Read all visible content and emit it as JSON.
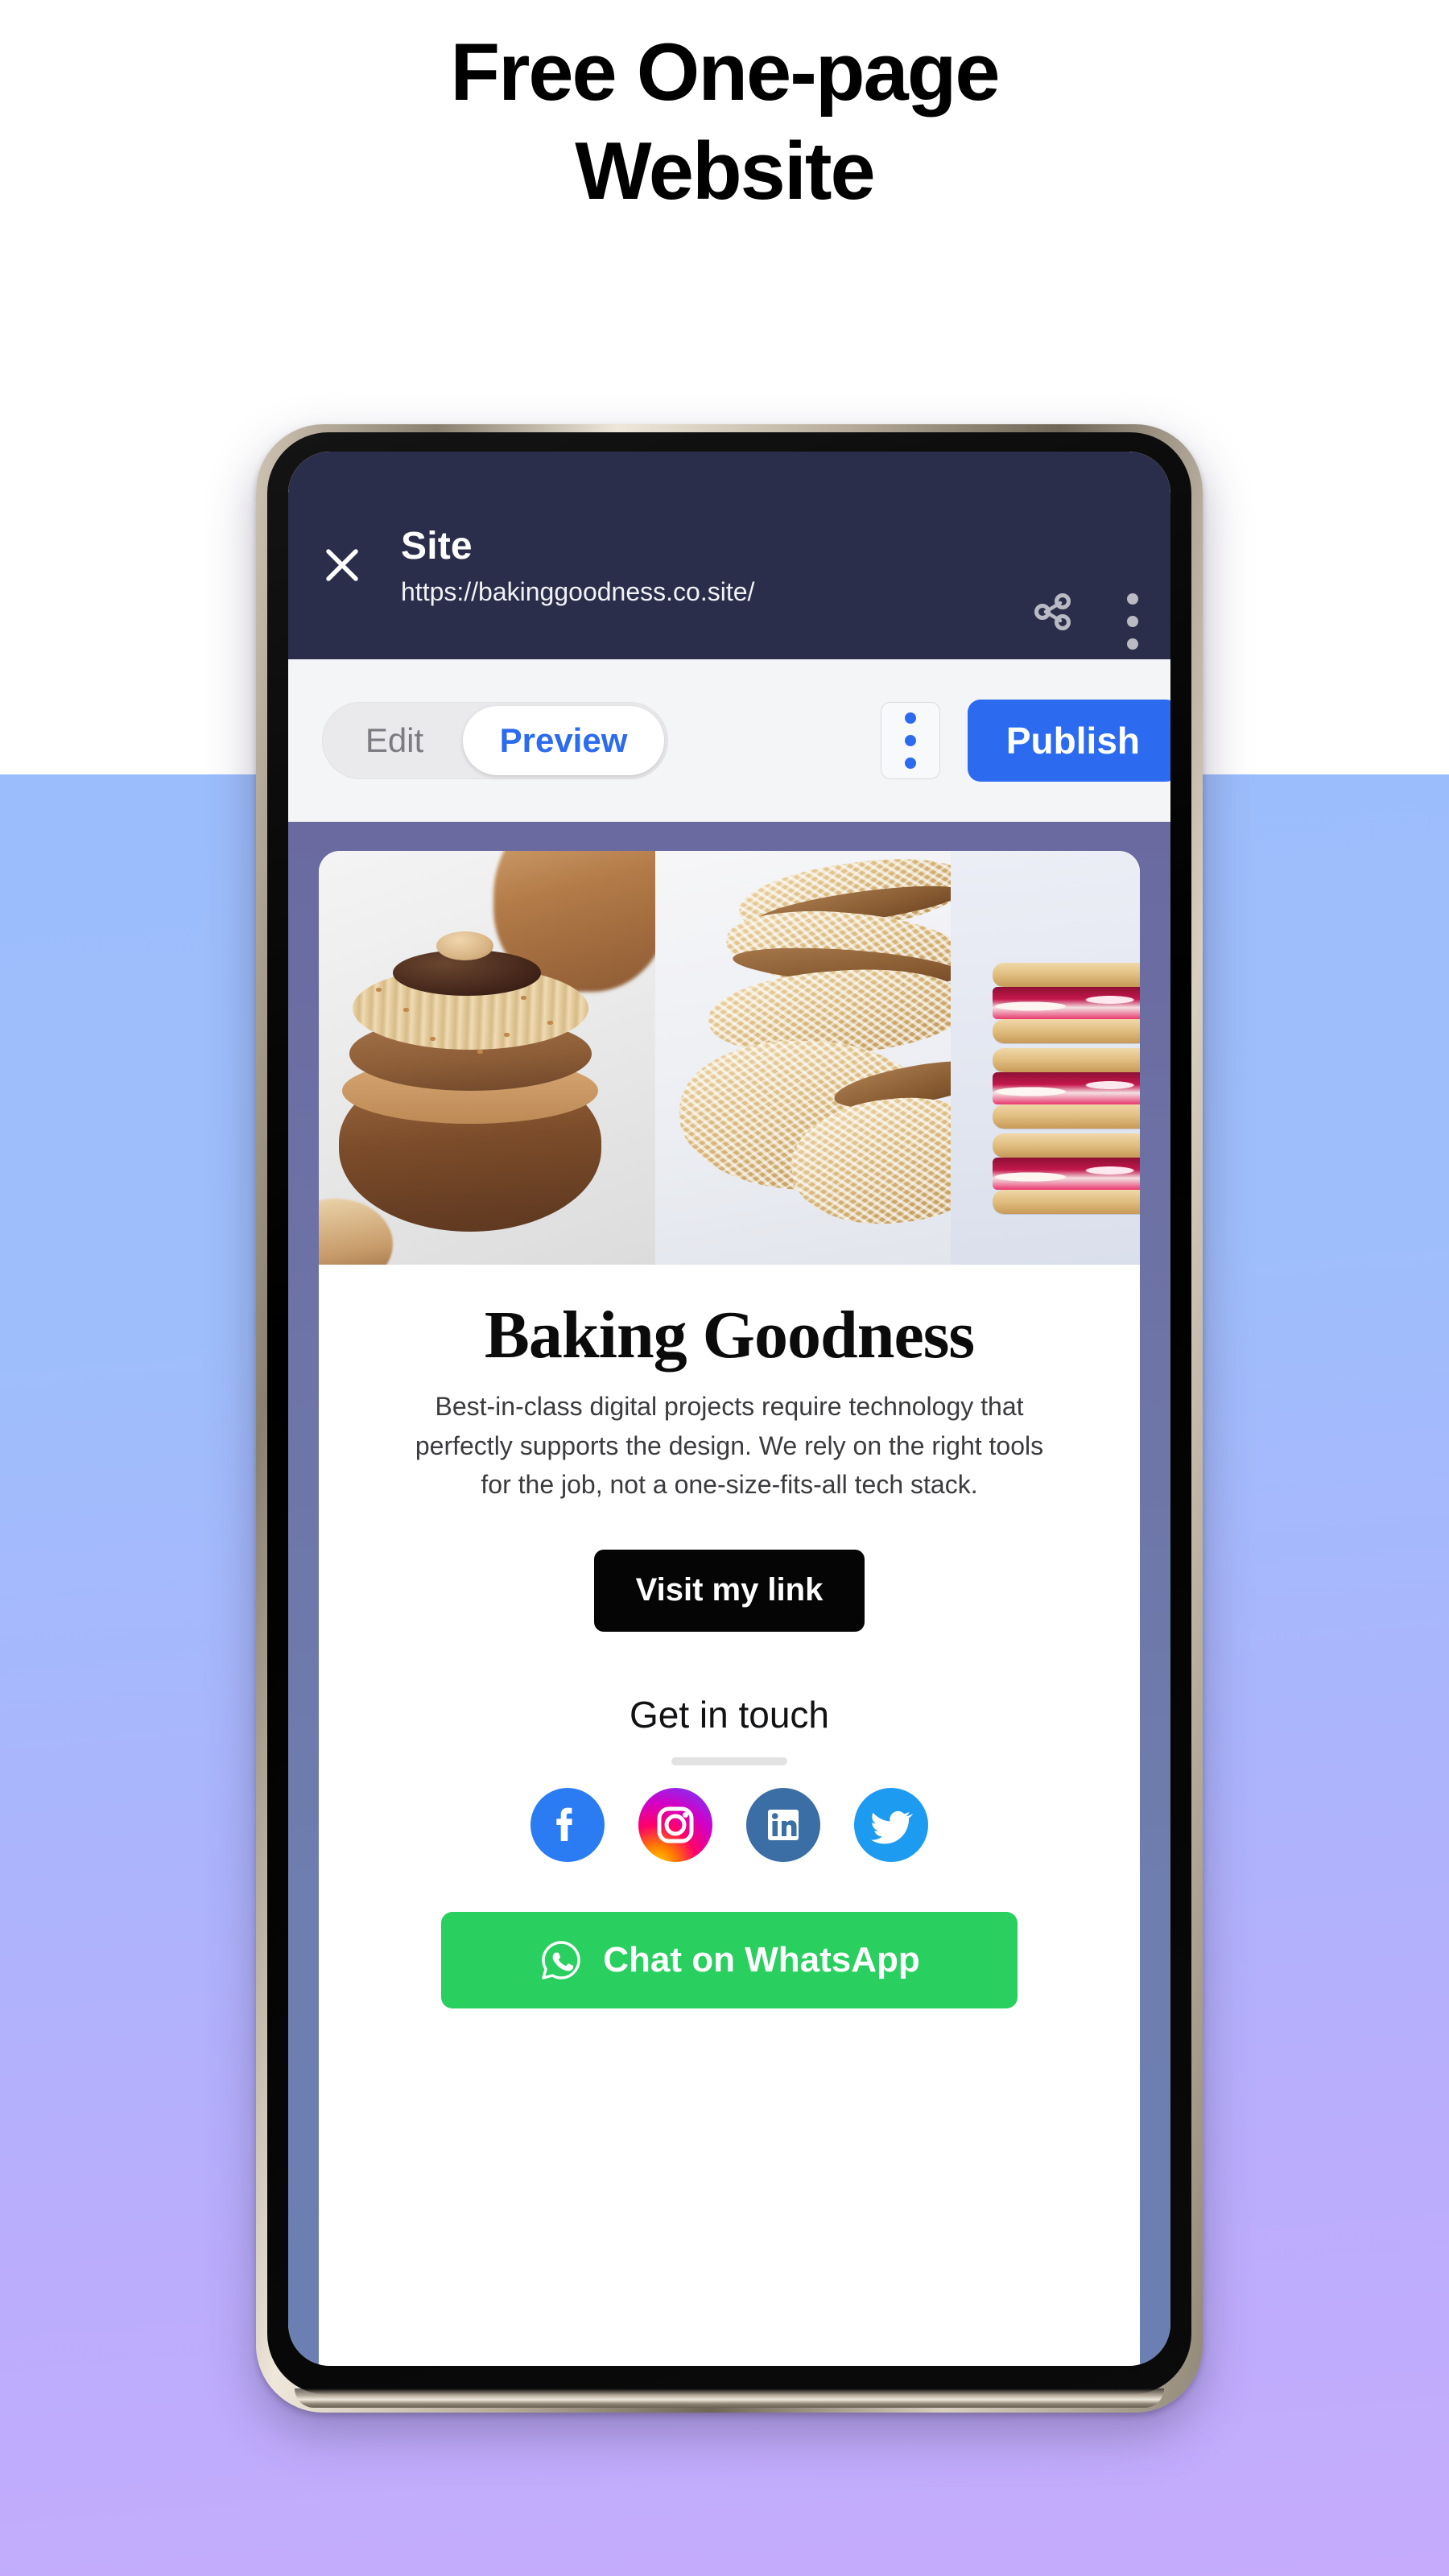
{
  "headline": {
    "line1": "Free One-page",
    "line2": "Website"
  },
  "colors": {
    "bg_top": "#FFFFFF",
    "bg_gradient_start": "#9CBDFB",
    "bg_gradient_end": "#C6ABFC",
    "app_header_bg": "#2A2E4A",
    "accent_blue": "#2C6BEF",
    "site_preview_bg": "#6A6AA0",
    "visit_button_bg": "#050505",
    "whatsapp_green": "#29CF5F"
  },
  "app_header": {
    "close_icon": "close-icon",
    "title": "Site",
    "url": "https://bakinggoodness.co.site/",
    "share_icon": "share-icon",
    "menu_icon": "kebab-menu-icon"
  },
  "toolbar": {
    "tabs": [
      {
        "label": "Edit",
        "active": false
      },
      {
        "label": "Preview",
        "active": true
      }
    ],
    "menu_icon": "kebab-menu-icon",
    "publish_label": "Publish"
  },
  "site": {
    "collage": {
      "panels": [
        "chocolate-hazelnut-pastry-photo",
        "almond-caramel-cookies-photo",
        "raspberry-cream-sandwich-cookies-photo"
      ]
    },
    "title": "Baking Goodness",
    "description": "Best-in-class digital projects require technology that perfectly supports the design. We rely on the right tools for the job, not a one-size-fits-all tech stack.",
    "visit_button_label": "Visit my link",
    "contact_heading": "Get in touch",
    "socials": [
      {
        "name": "facebook",
        "color": "#2B7CF3"
      },
      {
        "name": "instagram",
        "color": "#D62976"
      },
      {
        "name": "linkedin",
        "color": "#3A6EA5"
      },
      {
        "name": "twitter",
        "color": "#1D9BF0"
      }
    ],
    "whatsapp_label": "Chat on WhatsApp",
    "whatsapp_icon": "whatsapp-icon"
  }
}
